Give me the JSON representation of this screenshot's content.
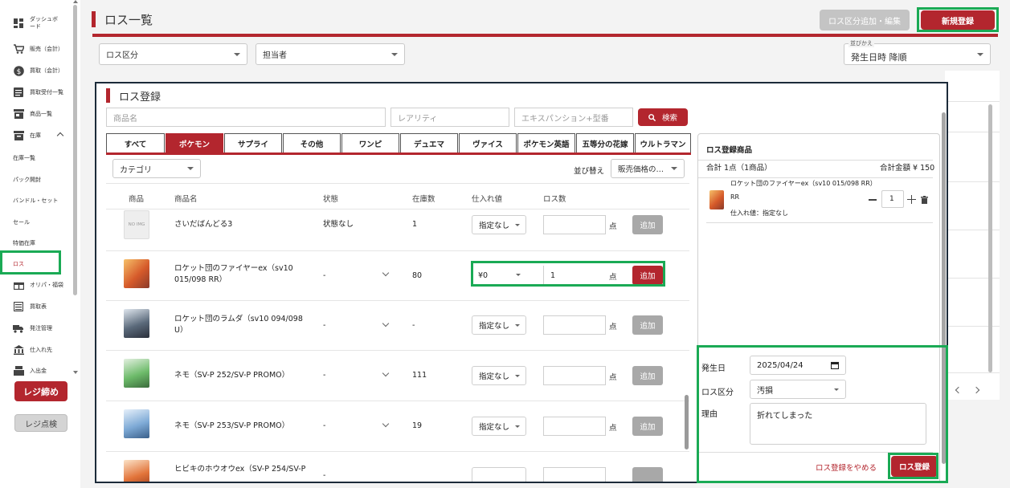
{
  "sidebar": {
    "items": [
      {
        "label": "ダッシュボード",
        "icon": "dashboard-icon"
      },
      {
        "label": "販売（会計）",
        "icon": "cart-icon"
      },
      {
        "label": "買取（会計）",
        "icon": "dollar-icon"
      },
      {
        "label": "買取受付一覧",
        "icon": "list-icon"
      },
      {
        "label": "商品一覧",
        "icon": "store-icon"
      },
      {
        "label": "在庫",
        "icon": "inventory-icon"
      },
      {
        "label": "在庫一覧"
      },
      {
        "label": "パック開封"
      },
      {
        "label": "バンドル・セット"
      },
      {
        "label": "セール"
      },
      {
        "label": "特価在庫"
      },
      {
        "label": "ロス"
      },
      {
        "label": "オリパ・福袋",
        "icon": "gift-icon"
      },
      {
        "label": "買取表",
        "icon": "table-icon"
      },
      {
        "label": "発注管理",
        "icon": "truck-icon"
      },
      {
        "label": "仕入れ先",
        "icon": "building-icon"
      },
      {
        "label": "入出金",
        "icon": "register-icon"
      }
    ],
    "close_register_label": "レジ締め",
    "check_register_label": "レジ点検"
  },
  "header": {
    "title": "ロス一覧",
    "edit_category_label": "ロス区分追加・編集",
    "new_label": "新規登録"
  },
  "filters": {
    "category": "ロス区分",
    "staff": "担当者",
    "sort_caption": "並びかえ",
    "sort_value": "発生日時 降順"
  },
  "modal": {
    "title": "ロス登録",
    "search": {
      "name_placeholder": "商品名",
      "rarity_placeholder": "レアリティ",
      "expansion_placeholder": "エキスパンション+型番",
      "button_label": "検索"
    },
    "tabs": [
      "すべて",
      "ポケモン",
      "サプライ",
      "その他",
      "ワンピ",
      "デュエマ",
      "ヴァイス",
      "ポケモン英語",
      "五等分の花嫁",
      "ウルトラマン"
    ],
    "active_tab": "ポケモン",
    "category_select": "カテゴリ",
    "sort_label": "並び替え",
    "sort_value": "販売価格の…",
    "columns": [
      "商品",
      "商品名",
      "状態",
      "在庫数",
      "仕入れ値",
      "ロス数"
    ],
    "no_image_label": "NO IMG",
    "unit_label": "点",
    "add_label": "追加",
    "rows": [
      {
        "name": "さいだばんどる3",
        "condition": "状態なし",
        "stock": "1",
        "price": "指定なし",
        "qty": "",
        "active": false
      },
      {
        "name": "ロケット団のファイヤーex（sv10 015/098 RR）",
        "condition": "-",
        "stock": "80",
        "price": "¥0",
        "qty": "1",
        "active": true
      },
      {
        "name": "ロケット団のラムダ（sv10 094/098 U）",
        "condition": "-",
        "stock": "-",
        "price": "指定なし",
        "qty": "",
        "active": false
      },
      {
        "name": "ネモ（SV-P 252/SV-P PROMO）",
        "condition": "-",
        "stock": "111",
        "price": "指定なし",
        "qty": "",
        "active": false
      },
      {
        "name": "ネモ（SV-P 253/SV-P PROMO）",
        "condition": "-",
        "stock": "19",
        "price": "指定なし",
        "qty": "",
        "active": false
      },
      {
        "name": "ヒビキのホウオウex（SV-P 254/SV-P",
        "condition": "-",
        "stock": "",
        "price": "",
        "qty": "",
        "active": false
      }
    ]
  },
  "panel": {
    "title": "ロス登録商品",
    "total_count": "合計 1点（1商品）",
    "total_amount": "合計金額 ¥ 150",
    "item_name": "ロケット団のファイヤーex（sv10 015/098 RR）",
    "item_rarity": "RR",
    "item_price": "仕入れ値：指定なし",
    "item_qty": "1",
    "date_label": "発生日",
    "date_value": "2025/04/24",
    "category_label": "ロス区分",
    "category_value": "汚損",
    "reason_label": "理由",
    "reason_value": "折れてしまった",
    "cancel_label": "ロス登録をやめる",
    "submit_label": "ロス登録"
  },
  "colors": {
    "accent": "#b3262e",
    "highlight": "#1aaa55",
    "modal_border": "#1c2b3a"
  }
}
